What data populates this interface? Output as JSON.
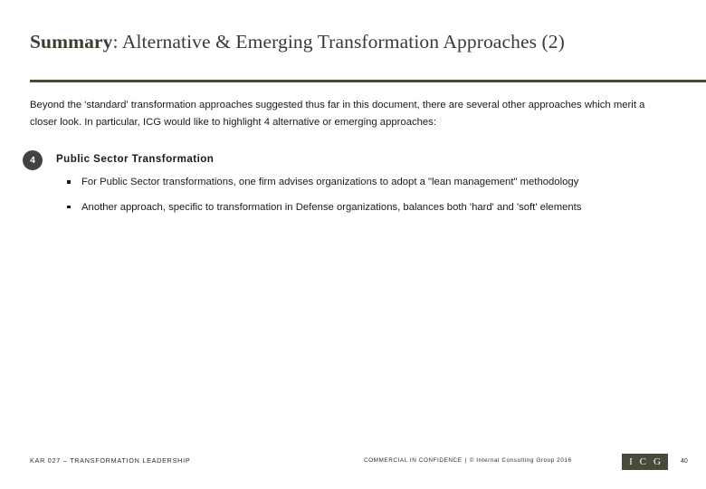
{
  "slide": {
    "title": {
      "lead": "Summary",
      "rest": ":  Alternative & Emerging Transformation Approaches (2)"
    },
    "intro_paragraph": "Beyond the 'standard' transformation approaches suggested thus far in this document, there are several other approaches which merit a closer look.  In particular, ICG would like to highlight 4 alternative or emerging approaches:",
    "section": {
      "badge_number": "4",
      "heading": "Public Sector Transformation",
      "bullets": [
        "For Public Sector transformations, one firm advises organizations to adopt a \"lean management\" methodology",
        "Another approach, specific to transformation in Defense organizations, balances both 'hard' and 'soft' elements"
      ]
    }
  },
  "footer": {
    "document_code": "KAR 027 – TRANSFORMATION LEADERSHIP",
    "confidentiality": "COMMERCIAL IN CONFIDENCE",
    "separator": "|",
    "copyright": "© Internal Consulting Group 2016",
    "logo_text": "I C G",
    "page_number": "40"
  },
  "colors": {
    "title_text": "#3d3a30",
    "divider": "#4a4a38",
    "badge_fill": "#434343",
    "logo_fill": "#4a4a38",
    "body_text": "#1a1a1a",
    "background": "#ffffff"
  }
}
